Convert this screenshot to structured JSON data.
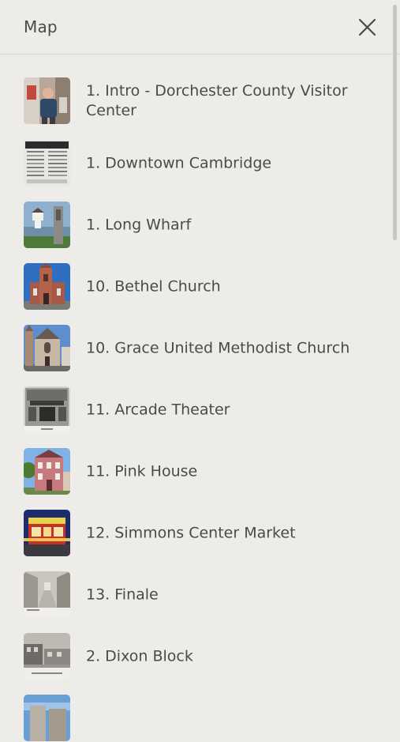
{
  "header": {
    "title": "Map",
    "close_icon": "close-icon"
  },
  "stops": [
    {
      "label": "1. Intro - Dorchester County Visitor Center",
      "thumb": "person-photo"
    },
    {
      "label": "1. Downtown Cambridge",
      "thumb": "document-photo"
    },
    {
      "label": "1. Long Wharf",
      "thumb": "lighthouse-photo"
    },
    {
      "label": "10. Bethel Church",
      "thumb": "brick-church-photo"
    },
    {
      "label": "10. Grace United Methodist Church",
      "thumb": "stone-church-photo"
    },
    {
      "label": "11. Arcade Theater",
      "thumb": "bw-theater-photo"
    },
    {
      "label": "11. Pink House",
      "thumb": "pink-house-photo"
    },
    {
      "label": "12. Simmons Center Market",
      "thumb": "night-market-photo"
    },
    {
      "label": "13. Finale",
      "thumb": "street-postcard-photo"
    },
    {
      "label": "2. Dixon Block",
      "thumb": "bw-street-photo"
    },
    {
      "label": "",
      "thumb": "sky-building-photo"
    }
  ]
}
